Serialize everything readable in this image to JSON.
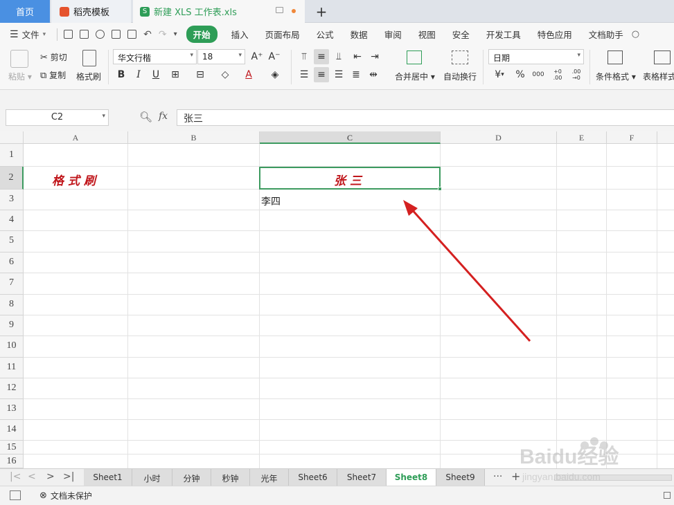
{
  "tabs": {
    "home": "首页",
    "template": "稻壳模板",
    "file": "新建 XLS 工作表.xls",
    "new_tab": "+"
  },
  "menu": {
    "file": "文件",
    "items": [
      "开始",
      "插入",
      "页面布局",
      "公式",
      "数据",
      "审阅",
      "视图",
      "安全",
      "开发工具",
      "特色应用",
      "文档助手"
    ]
  },
  "ribbon": {
    "paste": "粘贴",
    "cut": "剪切",
    "copy": "复制",
    "format_painter": "格式刷",
    "font_name": "华文行楷",
    "font_size": "18",
    "merge_center": "合并居中",
    "wrap_text": "自动换行",
    "number_format": "日期",
    "cond_format": "条件格式",
    "table_style": "表格样式",
    "bold": "B",
    "italic": "I",
    "underline": "U",
    "percent": "%",
    "thousands": "000",
    "inc_decimal": "+0 .00",
    "dec_decimal": ".00 →0",
    "currency": "¥"
  },
  "formula_bar": {
    "name_box": "C2",
    "fx_label": "fx",
    "value": "张三"
  },
  "columns": [
    "A",
    "B",
    "C",
    "D",
    "E",
    "F"
  ],
  "rows": [
    "1",
    "2",
    "3",
    "4",
    "5",
    "6",
    "7",
    "8",
    "9",
    "10",
    "11",
    "12",
    "13",
    "14",
    "15",
    "16"
  ],
  "cells": {
    "a2": "格式刷",
    "c2": "张三",
    "c3": "李四"
  },
  "sheets": [
    "Sheet1",
    "小时",
    "分钟",
    "秒钟",
    "光年",
    "Sheet6",
    "Sheet7",
    "Sheet8",
    "Sheet9"
  ],
  "active_sheet": "Sheet8",
  "status": {
    "protect": "文档未保护"
  },
  "watermark": {
    "brand": "Baidu经验",
    "url": "jingyan.baidu.com"
  },
  "colors": {
    "accent": "#2e9d57",
    "format_text": "#c0161b",
    "arrow": "#d42020",
    "home_tab": "#4a90e2"
  }
}
